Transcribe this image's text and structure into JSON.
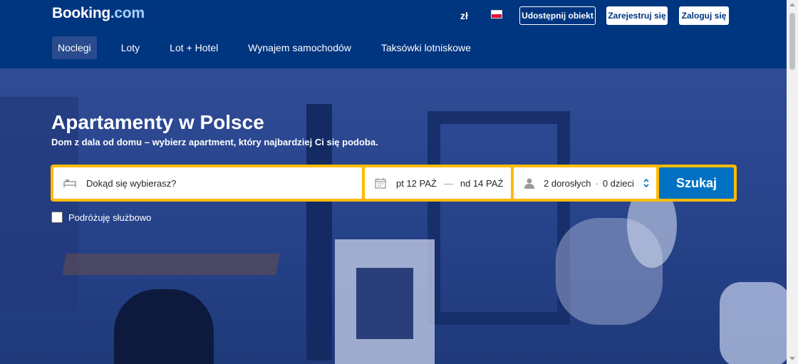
{
  "header": {
    "logo_main": "Booking",
    "logo_suffix": ".com",
    "currency": "zł",
    "language_flag": "PL",
    "list_property_label": "Udostępnij obiekt",
    "register_label": "Zarejestruj się",
    "login_label": "Zaloguj się"
  },
  "nav": {
    "items": [
      {
        "label": "Noclegi",
        "active": true
      },
      {
        "label": "Loty",
        "active": false
      },
      {
        "label": "Lot + Hotel",
        "active": false
      },
      {
        "label": "Wynajem samochodów",
        "active": false
      },
      {
        "label": "Taksówki lotniskowe",
        "active": false
      }
    ]
  },
  "hero": {
    "title": "Apartamenty w Polsce",
    "subtitle": "Dom z dala od domu – wybierz apartment, który najbardziej Ci się podoba."
  },
  "search": {
    "destination_placeholder": "Dokąd się wybierasz?",
    "checkin": "pt 12 PAŹ",
    "date_separator": "—",
    "checkout": "nd 14 PAŹ",
    "adults": "2 dorosłych",
    "guest_separator": "·",
    "children": "0 dzieci",
    "submit_label": "Szukaj"
  },
  "business_trip": {
    "label": "Podróżuję służbowo",
    "checked": false
  },
  "colors": {
    "brand_blue": "#003580",
    "search_border": "#febb02",
    "button_blue": "#0071c2",
    "logo_suffix": "#a8d1ff"
  },
  "icons": {
    "destination": "bed-icon",
    "dates": "calendar-icon",
    "guests": "person-icon",
    "guests_toggle": "chevron-updown-icon"
  }
}
